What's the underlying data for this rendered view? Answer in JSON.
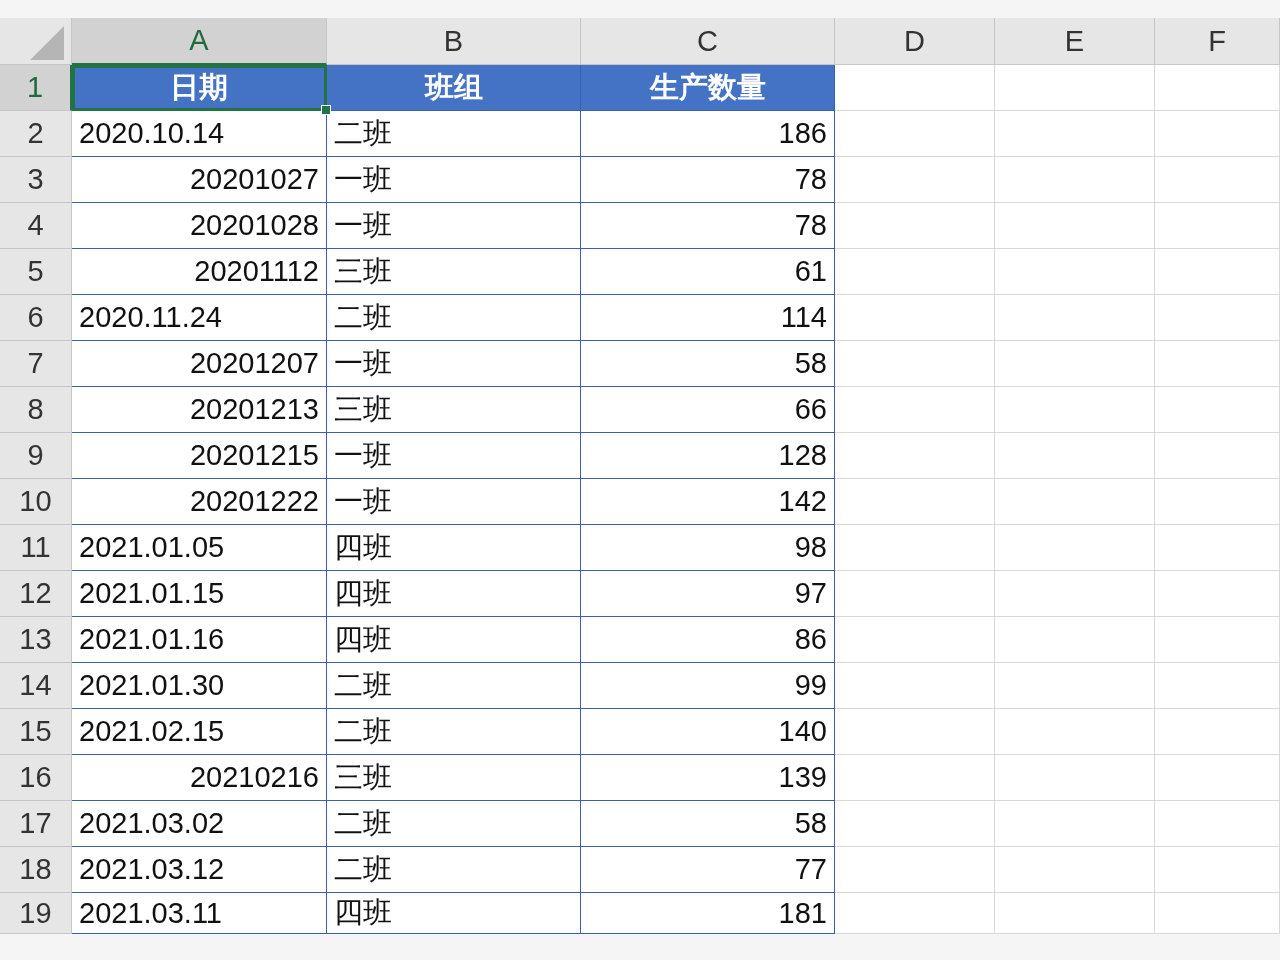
{
  "columns": [
    {
      "label": "A",
      "selected": true
    },
    {
      "label": "B",
      "selected": false
    },
    {
      "label": "C",
      "selected": false
    },
    {
      "label": "D",
      "selected": false
    },
    {
      "label": "E",
      "selected": false
    },
    {
      "label": "F",
      "selected": false
    }
  ],
  "header_row": {
    "row": "1",
    "selected": true,
    "cells": [
      {
        "text": "日期",
        "selected": true
      },
      {
        "text": "班组",
        "selected": false
      },
      {
        "text": "生产数量",
        "selected": false
      }
    ]
  },
  "rows": [
    {
      "row": "2",
      "selected": false,
      "cells": [
        {
          "text": "2020.10.14",
          "kind": "text"
        },
        {
          "text": "二班",
          "kind": "text"
        },
        {
          "text": "186",
          "kind": "number"
        }
      ]
    },
    {
      "row": "3",
      "selected": false,
      "cells": [
        {
          "text": "20201027",
          "kind": "number"
        },
        {
          "text": "一班",
          "kind": "text"
        },
        {
          "text": "78",
          "kind": "number"
        }
      ]
    },
    {
      "row": "4",
      "selected": false,
      "cells": [
        {
          "text": "20201028",
          "kind": "number"
        },
        {
          "text": "一班",
          "kind": "text"
        },
        {
          "text": "78",
          "kind": "number"
        }
      ]
    },
    {
      "row": "5",
      "selected": false,
      "cells": [
        {
          "text": "20201112",
          "kind": "number"
        },
        {
          "text": "三班",
          "kind": "text"
        },
        {
          "text": "61",
          "kind": "number"
        }
      ]
    },
    {
      "row": "6",
      "selected": false,
      "cells": [
        {
          "text": "2020.11.24",
          "kind": "text"
        },
        {
          "text": "二班",
          "kind": "text"
        },
        {
          "text": "114",
          "kind": "number"
        }
      ]
    },
    {
      "row": "7",
      "selected": false,
      "cells": [
        {
          "text": "20201207",
          "kind": "number"
        },
        {
          "text": "一班",
          "kind": "text"
        },
        {
          "text": "58",
          "kind": "number"
        }
      ]
    },
    {
      "row": "8",
      "selected": false,
      "cells": [
        {
          "text": "20201213",
          "kind": "number"
        },
        {
          "text": "三班",
          "kind": "text"
        },
        {
          "text": "66",
          "kind": "number"
        }
      ]
    },
    {
      "row": "9",
      "selected": false,
      "cells": [
        {
          "text": "20201215",
          "kind": "number"
        },
        {
          "text": "一班",
          "kind": "text"
        },
        {
          "text": "128",
          "kind": "number"
        }
      ]
    },
    {
      "row": "10",
      "selected": false,
      "cells": [
        {
          "text": "20201222",
          "kind": "number"
        },
        {
          "text": "一班",
          "kind": "text"
        },
        {
          "text": "142",
          "kind": "number"
        }
      ]
    },
    {
      "row": "11",
      "selected": false,
      "cells": [
        {
          "text": "2021.01.05",
          "kind": "text"
        },
        {
          "text": "四班",
          "kind": "text"
        },
        {
          "text": "98",
          "kind": "number"
        }
      ]
    },
    {
      "row": "12",
      "selected": false,
      "cells": [
        {
          "text": "2021.01.15",
          "kind": "text"
        },
        {
          "text": "四班",
          "kind": "text"
        },
        {
          "text": "97",
          "kind": "number"
        }
      ]
    },
    {
      "row": "13",
      "selected": false,
      "cells": [
        {
          "text": "2021.01.16",
          "kind": "text"
        },
        {
          "text": "四班",
          "kind": "text"
        },
        {
          "text": "86",
          "kind": "number"
        }
      ]
    },
    {
      "row": "14",
      "selected": false,
      "cells": [
        {
          "text": "2021.01.30",
          "kind": "text"
        },
        {
          "text": "二班",
          "kind": "text"
        },
        {
          "text": "99",
          "kind": "number"
        }
      ]
    },
    {
      "row": "15",
      "selected": false,
      "cells": [
        {
          "text": "2021.02.15",
          "kind": "text"
        },
        {
          "text": "二班",
          "kind": "text"
        },
        {
          "text": "140",
          "kind": "number"
        }
      ]
    },
    {
      "row": "16",
      "selected": false,
      "cells": [
        {
          "text": "20210216",
          "kind": "number"
        },
        {
          "text": "三班",
          "kind": "text"
        },
        {
          "text": "139",
          "kind": "number"
        }
      ]
    },
    {
      "row": "17",
      "selected": false,
      "cells": [
        {
          "text": "2021.03.02",
          "kind": "text"
        },
        {
          "text": "二班",
          "kind": "text"
        },
        {
          "text": "58",
          "kind": "number"
        }
      ]
    },
    {
      "row": "18",
      "selected": false,
      "cells": [
        {
          "text": "2021.03.12",
          "kind": "text"
        },
        {
          "text": "二班",
          "kind": "text"
        },
        {
          "text": "77",
          "kind": "number"
        }
      ]
    },
    {
      "row": "19",
      "selected": false,
      "cells": [
        {
          "text": "2021.03.11",
          "kind": "text"
        },
        {
          "text": "四班",
          "kind": "text"
        },
        {
          "text": "181",
          "kind": "number"
        }
      ]
    }
  ]
}
